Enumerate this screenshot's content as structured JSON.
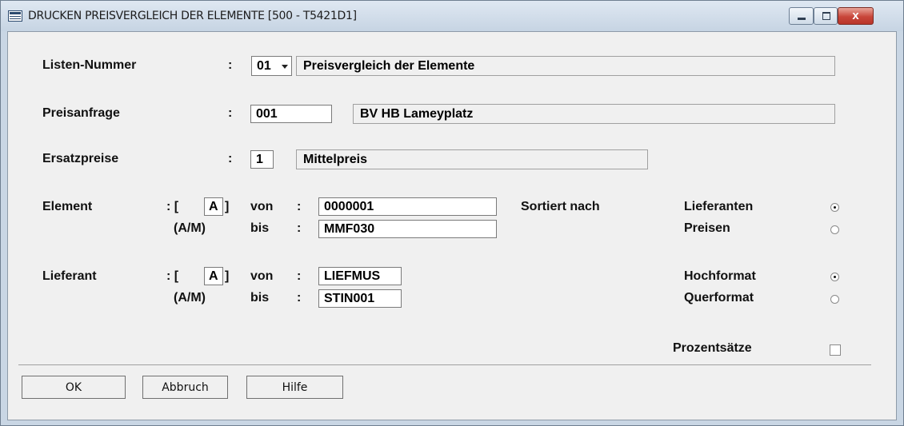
{
  "window": {
    "title": "DRUCKEN PREISVERGLEICH DER ELEMENTE  [500 - T5421D1]",
    "close_glyph": "x"
  },
  "liste": {
    "label": "Listen-Nummer",
    "colon": ":",
    "value": "01",
    "description": "Preisvergleich der Elemente"
  },
  "preisanfrage": {
    "label": "Preisanfrage",
    "colon": ":",
    "value": "001",
    "description": "BV HB Lameyplatz"
  },
  "ersatzpreise": {
    "label": "Ersatzpreise",
    "colon": ":",
    "value": "1",
    "description": "Mittelpreis"
  },
  "element": {
    "label": "Element",
    "mode_prefix": ": [",
    "mode": "A",
    "mode_suffix": "]",
    "mode_hint": "(A/M)",
    "von_label": "von",
    "von_colon": ":",
    "von_value": "0000001",
    "bis_label": "bis",
    "bis_colon": ":",
    "bis_value": "MMF030"
  },
  "lieferant": {
    "label": "Lieferant",
    "mode_prefix": ": [",
    "mode": "A",
    "mode_suffix": "]",
    "mode_hint": "(A/M)",
    "von_label": "von",
    "von_colon": ":",
    "von_value": "LIEFMUS",
    "bis_label": "bis",
    "bis_colon": ":",
    "bis_value": "STIN001"
  },
  "sortierung": {
    "label": "Sortiert nach",
    "options": [
      {
        "label": "Lieferanten",
        "selected": true
      },
      {
        "label": "Preisen",
        "selected": false
      }
    ]
  },
  "format": {
    "options": [
      {
        "label": "Hochformat",
        "selected": true
      },
      {
        "label": "Querformat",
        "selected": false
      }
    ]
  },
  "prozentsaetze": {
    "label": "Prozentsätze",
    "checked": false
  },
  "buttons": {
    "ok": "OK",
    "cancel": "Abbruch",
    "help": "Hilfe"
  }
}
